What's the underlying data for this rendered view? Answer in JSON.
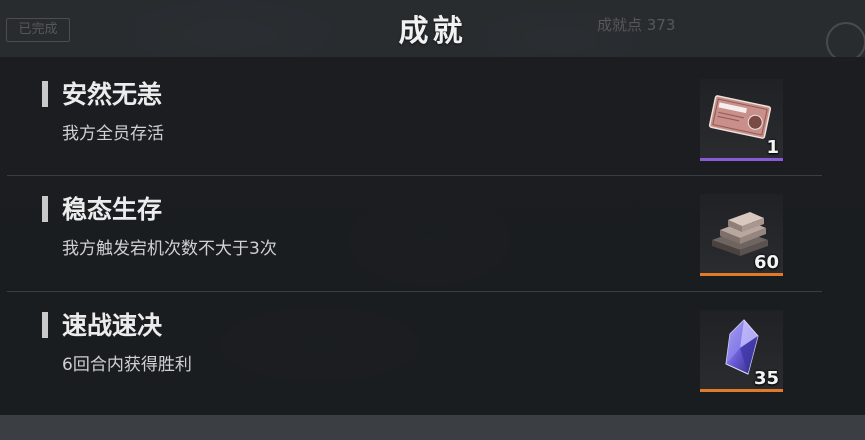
{
  "header": {
    "title": "成就",
    "ghost_left": "已完成",
    "ghost_right": "成就点 373"
  },
  "achievements": [
    {
      "title": "安然无恙",
      "description": "我方全员存活",
      "reward": {
        "icon": "ticket-icon",
        "quantity": "1",
        "rarity_color": "#8a5bd6"
      }
    },
    {
      "title": "稳态生存",
      "description": "我方触发宕机次数不大于3次",
      "reward": {
        "icon": "metal-bars-icon",
        "quantity": "60",
        "rarity_color": "#e0792a"
      }
    },
    {
      "title": "速战速决",
      "description": "6回合内获得胜利",
      "reward": {
        "icon": "crystal-icon",
        "quantity": "35",
        "rarity_color": "#e0792a"
      }
    }
  ]
}
